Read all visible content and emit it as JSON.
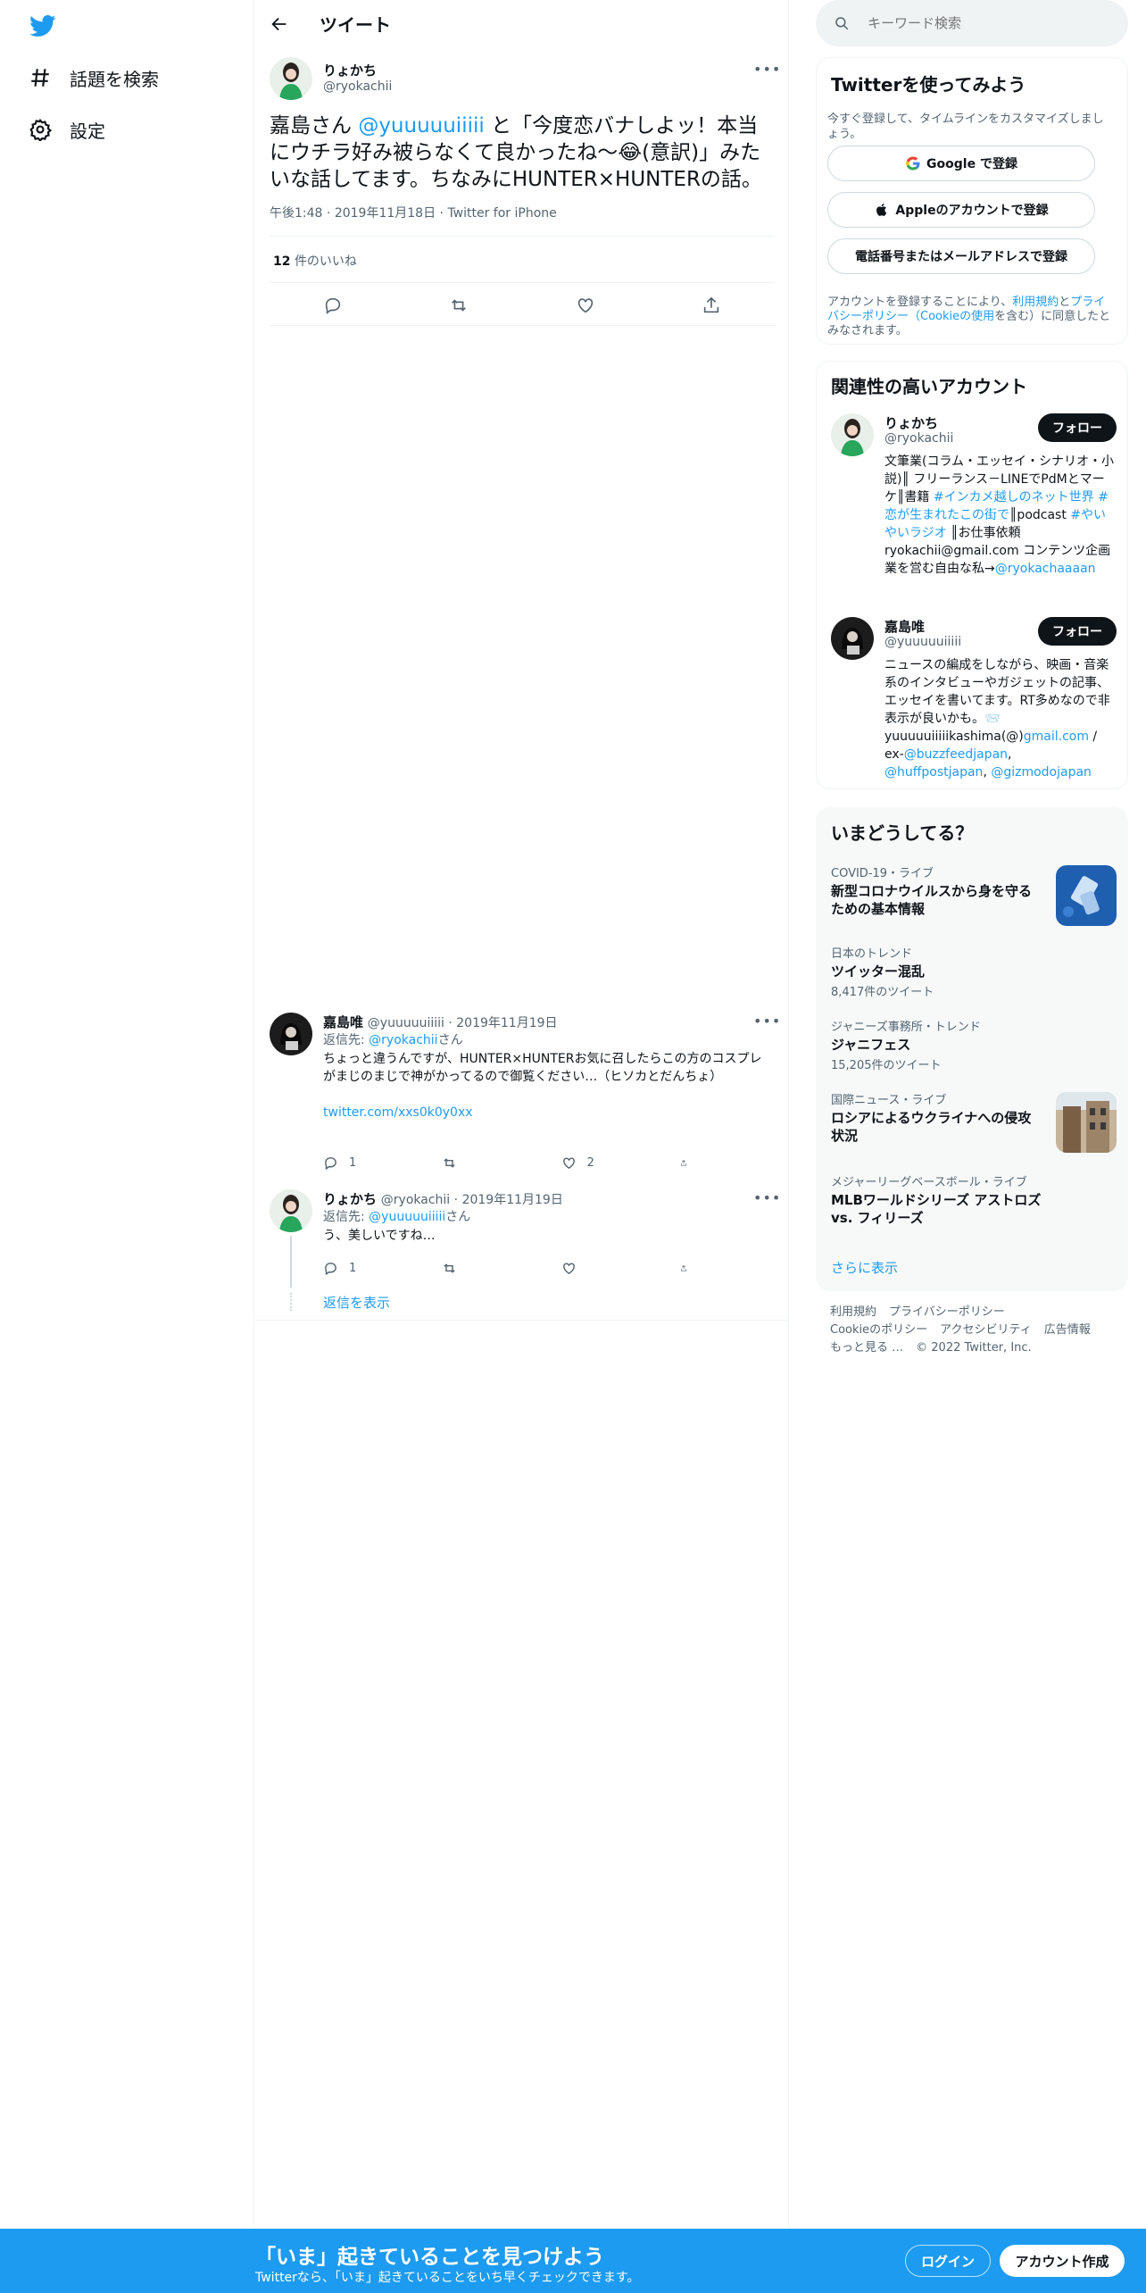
{
  "colors": {
    "accent": "#1d9bf0",
    "text": "#0f1419",
    "muted": "#536471"
  },
  "leftnav": {
    "logo_icon": "twitter-bird-icon",
    "items": [
      {
        "label": "話題を検索",
        "icon": "hashtag-icon"
      },
      {
        "label": "設定",
        "icon": "gear-icon"
      }
    ]
  },
  "main": {
    "title": "ツイート",
    "tweet": {
      "author_name": "りょかち",
      "author_handle": "@ryokachii",
      "text_pre": "嘉島さん ",
      "mention": "@yuuuuuiiiii",
      "text_post": " と「今度恋バナしよッ！本当にウチラ好み被らなくて良かったね〜😂(意訳)」みたいな話してます。ちなみにHUNTER×HUNTERの話。",
      "time": "午後1:48",
      "date": "2019年11月18日",
      "source": "Twitter for iPhone",
      "likes_count": "12",
      "likes_label": "件のいいね"
    },
    "replies": [
      {
        "name": "嘉島唯",
        "handle": "@yuuuuuiiiii",
        "date": "2019年11月19日",
        "reply_to_label": "返信先: ",
        "reply_to_handle": "@ryokachii",
        "reply_to_suffix": "さん",
        "text": "ちょっと違うんですが、HUNTER×HUNTERお気に召したらこの方のコスプレがまじのまじで神がかってるので御覧ください…（ヒソカとだんちょ）",
        "link": "twitter.com/xxs0k0y0xx",
        "reply_count": "1",
        "retweet_count": "",
        "like_count": "2"
      },
      {
        "name": "りょかち",
        "handle": "@ryokachii",
        "date": "2019年11月19日",
        "reply_to_label": "返信先: ",
        "reply_to_handle": "@yuuuuuiiiii",
        "reply_to_suffix": "さん",
        "text": "う、美しいですね…",
        "reply_count": "1",
        "retweet_count": "",
        "like_count": ""
      }
    ],
    "show_replies": "返信を表示"
  },
  "right": {
    "search_placeholder": "キーワード検索",
    "signup": {
      "title": "Twitterを使ってみよう",
      "desc": "今すぐ登録して、タイムラインをカスタマイズしましょう。",
      "google": "Google で登録",
      "apple": "Appleのアカウントで登録",
      "phone": "電話番号またはメールアドレスで登録",
      "legal_1": "アカウントを登録することにより、",
      "legal_terms": "利用規約",
      "legal_2": "と",
      "legal_privacy": "プライバシーポリシー（Cookieの使用",
      "legal_3": "を含む）に同意したとみなされます。"
    },
    "relevant": {
      "title": "関連性の高いアカウント",
      "follow_label": "フォロー",
      "accounts": [
        {
          "name": "りょかち",
          "handle": "@ryokachii",
          "bio_1": "文筆業(コラム・エッセイ・シナリオ・小説)║ フリーランス－LINEでPdMとマーケ║書籍 ",
          "bio_tag1": "#インカメ越しのネット世界",
          "bio_sp": " ",
          "bio_tag2": "#恋が生まれたこの街で",
          "bio_2": "║podcast ",
          "bio_tag3": "#やいやいラジオ",
          "bio_3": " ║お仕事依頼 ryokachii@gmail.com コンテンツ企画業を営む自由な私→",
          "bio_link": "@ryokachaaaan"
        },
        {
          "name": "嘉島唯",
          "handle": "@yuuuuuiiiii",
          "bio_1": "ニュースの編成をしながら、映画・音楽系のインタビューやガジェットの記事、エッセイを書いてます。RT多めなので非表示が良いかも。📨 yuuuuuiiiiikashima(@)",
          "bio_link1": "gmail.com",
          "bio_2": " / ex-",
          "bio_link2": "@buzzfeedjapan",
          "bio_3": ", ",
          "bio_link3": "@huffpostjapan",
          "bio_4": ", ",
          "bio_link4": "@gizmodojapan"
        }
      ]
    },
    "trends": {
      "title": "いまどうしてる？",
      "items": [
        {
          "context": "COVID-19・ライブ",
          "title": "新型コロナウイルスから身を守るための基本情報",
          "count": ""
        },
        {
          "context": "日本のトレンド",
          "title": "ツイッター混乱",
          "count": "8,417件のツイート"
        },
        {
          "context": "ジャニーズ事務所・トレンド",
          "title": "ジャニフェス",
          "count": "15,205件のツイート"
        },
        {
          "context": "国際ニュース・ライブ",
          "title": "ロシアによるウクライナへの侵攻状況",
          "count": ""
        },
        {
          "context": "メジャーリーグベースボール・ライブ",
          "title": "MLBワールドシリーズ アストロズ vs. フィリーズ",
          "count": ""
        }
      ],
      "show_more": "さらに表示"
    },
    "footer": {
      "links": [
        "利用規約",
        "プライバシーポリシー",
        "Cookieのポリシー",
        "アクセシビリティ",
        "広告情報",
        "もっと見る …"
      ],
      "copyright": "© 2022 Twitter, Inc."
    }
  },
  "bottombar": {
    "title": "「いま」起きていることを見つけよう",
    "subtitle": "Twitterなら、「いま」起きていることをいち早くチェックできます。",
    "login": "ログイン",
    "signup": "アカウント作成"
  }
}
